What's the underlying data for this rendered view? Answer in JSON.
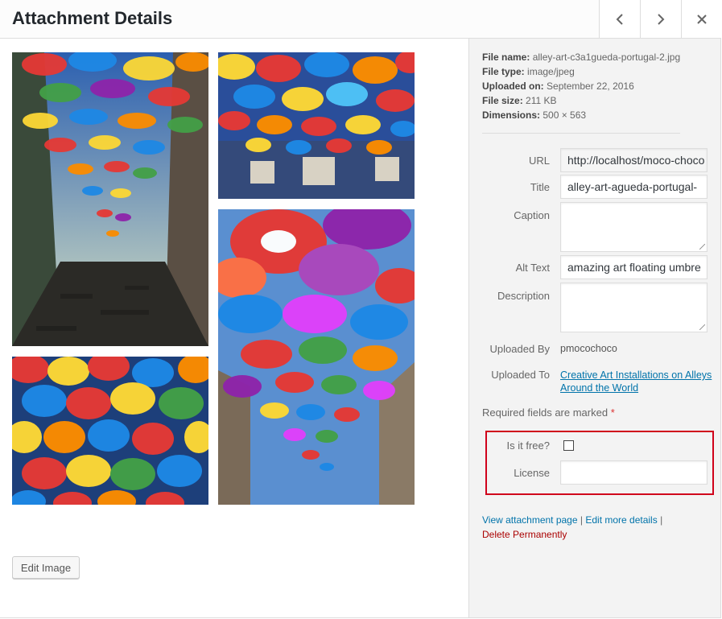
{
  "header": {
    "title": "Attachment Details",
    "prev_icon": "chevron-left-icon",
    "next_icon": "chevron-right-icon",
    "close_icon": "close-icon"
  },
  "gallery": {
    "edit_button": "Edit Image"
  },
  "details": {
    "file_name_label": "File name:",
    "file_name": "alley-art-c3a1gueda-portugal-2.jpg",
    "file_type_label": "File type:",
    "file_type": "image/jpeg",
    "uploaded_on_label": "Uploaded on:",
    "uploaded_on": "September 22, 2016",
    "file_size_label": "File size:",
    "file_size": "211 KB",
    "dimensions_label": "Dimensions:",
    "dimensions": "500 × 563"
  },
  "fields": {
    "url_label": "URL",
    "url_value": "http://localhost/moco-choco",
    "title_label": "Title",
    "title_value": "alley-art-agueda-portugal-",
    "caption_label": "Caption",
    "caption_value": "",
    "alt_label": "Alt Text",
    "alt_value": "amazing art floating umbre",
    "description_label": "Description",
    "description_value": "",
    "uploaded_by_label": "Uploaded By",
    "uploaded_by_value": "pmocochoco",
    "uploaded_to_label": "Uploaded To",
    "uploaded_to_value_line1": "Creative Art Installations on Alleys",
    "uploaded_to_value_line2": "Around the World"
  },
  "required_note": "Required fields are marked",
  "required_star": "*",
  "custom": {
    "free_label": "Is it free?",
    "free_checked": false,
    "license_label": "License",
    "license_value": ""
  },
  "actions": {
    "view_page": "View attachment page",
    "sep1": "|",
    "edit_more": "Edit more details",
    "sep2": "|",
    "delete": "Delete Permanently"
  },
  "colors": {
    "link": "#0073aa",
    "delete": "#aa0000",
    "highlight_box": "#d0021b",
    "sidebar_bg": "#f3f3f3"
  }
}
